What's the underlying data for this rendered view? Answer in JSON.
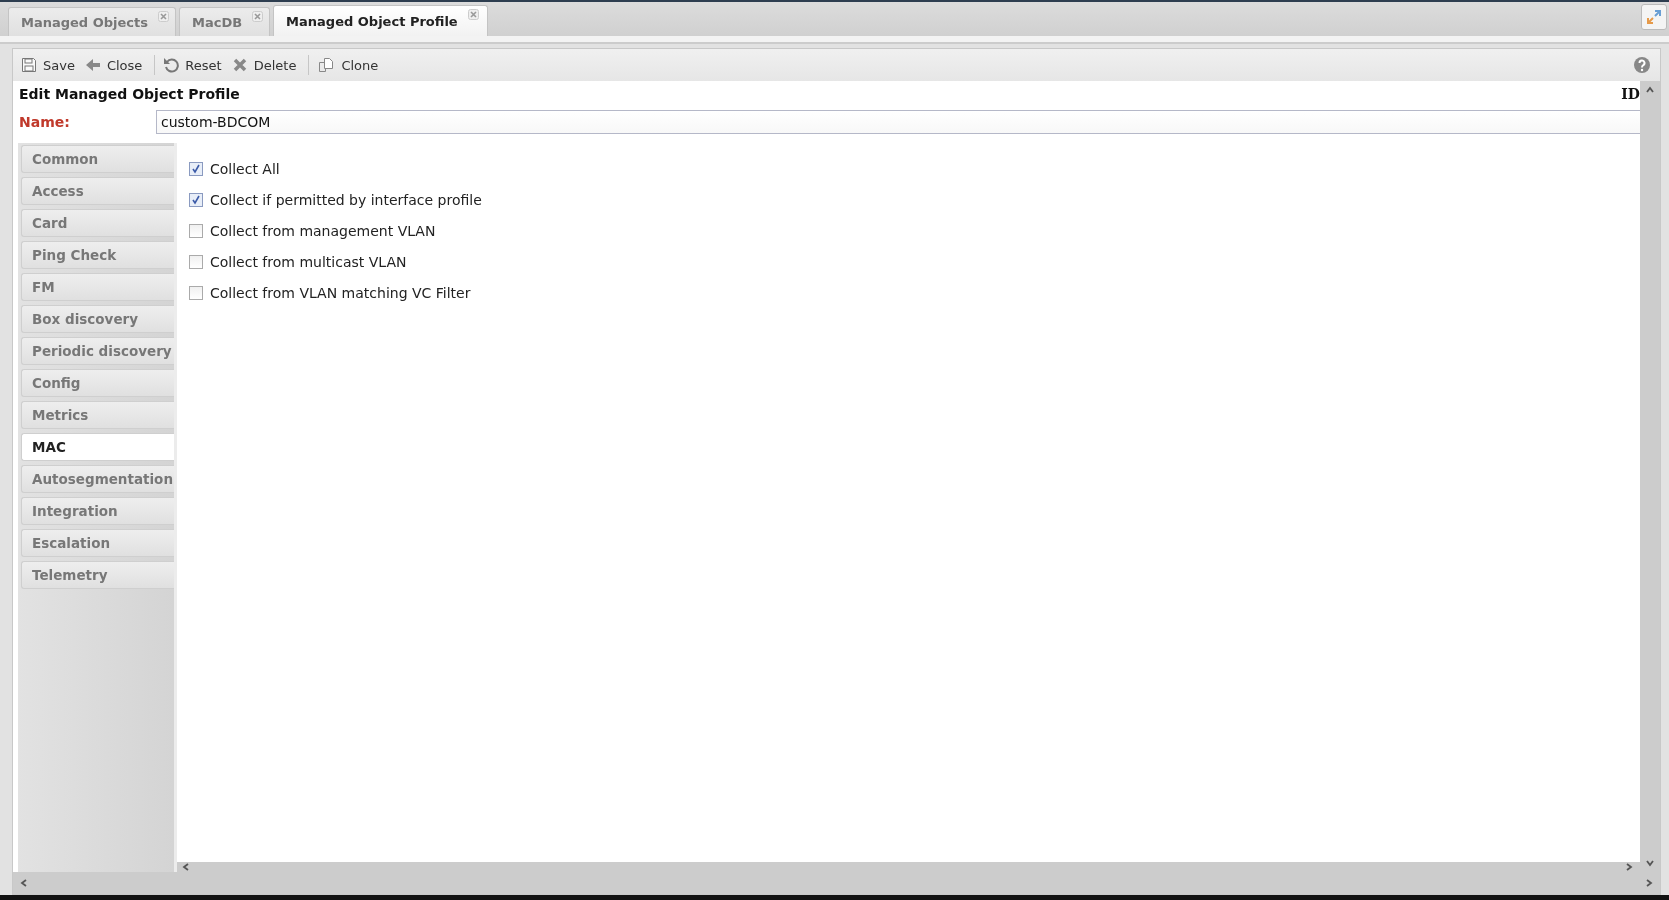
{
  "tabs": [
    {
      "label": "Managed Objects",
      "selected": false
    },
    {
      "label": "MacDB",
      "selected": false
    },
    {
      "label": "Managed Object Profile",
      "selected": true
    }
  ],
  "toolbar": [
    [
      {
        "label": "Save",
        "kind": "save"
      },
      {
        "label": "Close",
        "kind": "back"
      }
    ],
    [
      {
        "label": "Reset",
        "kind": "reset"
      },
      {
        "label": "Delete",
        "kind": "delete"
      }
    ],
    [
      {
        "label": "Clone",
        "kind": "clone"
      }
    ]
  ],
  "form": {
    "title": "Edit Managed Object Profile",
    "id_label": "ID",
    "name_label": "Name:",
    "name_value": "custom-BDCOM"
  },
  "sections": [
    {
      "label": "Common",
      "selected": false
    },
    {
      "label": "Access",
      "selected": false
    },
    {
      "label": "Card",
      "selected": false
    },
    {
      "label": "Ping Check",
      "selected": false
    },
    {
      "label": "FM",
      "selected": false
    },
    {
      "label": "Box discovery",
      "selected": false
    },
    {
      "label": "Periodic discovery",
      "selected": false
    },
    {
      "label": "Config",
      "selected": false
    },
    {
      "label": "Metrics",
      "selected": false
    },
    {
      "label": "MAC",
      "selected": true
    },
    {
      "label": "Autosegmentation",
      "selected": false
    },
    {
      "label": "Integration",
      "selected": false
    },
    {
      "label": "Escalation",
      "selected": false
    },
    {
      "label": "Telemetry",
      "selected": false
    }
  ],
  "options": [
    {
      "label": "Collect All",
      "checked": true
    },
    {
      "label": "Collect if permitted by interface profile",
      "checked": true
    },
    {
      "label": "Collect from management VLAN",
      "checked": false
    },
    {
      "label": "Collect from multicast VLAN",
      "checked": false
    },
    {
      "label": "Collect from VLAN matching VC Filter",
      "checked": false
    }
  ]
}
